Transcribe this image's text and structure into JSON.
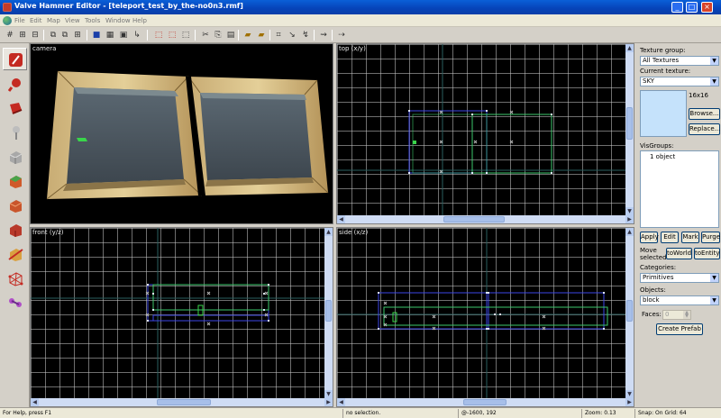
{
  "window": {
    "title": "Valve Hammer Editor - [teleport_test_by_the-no0n3.rmf]"
  },
  "menu": [
    "File",
    "Edit",
    "Map",
    "View",
    "Tools",
    "Window",
    "Help"
  ],
  "tools": [
    "selection-tool",
    "magnify-tool",
    "camera-tool",
    "entity-tool",
    "block-tool",
    "texture-application-tool",
    "apply-current-texture-tool",
    "decal-tool",
    "clipping-tool",
    "vertex-manipulation-tool",
    "path-tool"
  ],
  "viewports": {
    "camera": {
      "label": "camera"
    },
    "top": {
      "label": "top (x/y)"
    },
    "front": {
      "label": "front (y/z)"
    },
    "side": {
      "label": "side (x/z)"
    }
  },
  "panel": {
    "texture_group_label": "Texture group:",
    "texture_group_value": "All Textures",
    "current_texture_label": "Current texture:",
    "current_texture_value": "SKY",
    "texture_size": "16x16",
    "browse": "Browse...",
    "replace": "Replace...",
    "visgroups_label": "VisGroups:",
    "visgroups_items": [
      "1 object"
    ],
    "apply": "Apply",
    "edit": "Edit",
    "mark": "Mark",
    "purge": "Purge",
    "move_selected": "Move selected:",
    "to_world": "toWorld",
    "to_entity": "toEntity",
    "categories_label": "Categories:",
    "categories_value": "Primitives",
    "objects_label": "Objects:",
    "objects_value": "block",
    "faces_label": "Faces:",
    "faces_value": "0",
    "create_prefab": "Create Prefab"
  },
  "status": {
    "help": "For Help, press F1",
    "selection": "no selection.",
    "coords": "@-1600, 192",
    "zoom": "Zoom: 0.13",
    "snap": "Snap: On Grid: 64"
  },
  "colors": {
    "title_bar": "#0a5fd8",
    "brush_blue": "#3c46e6",
    "brush_green": "#3cc96b",
    "entity_green": "#39d64a",
    "sky_texture": "#c5e2fb"
  }
}
